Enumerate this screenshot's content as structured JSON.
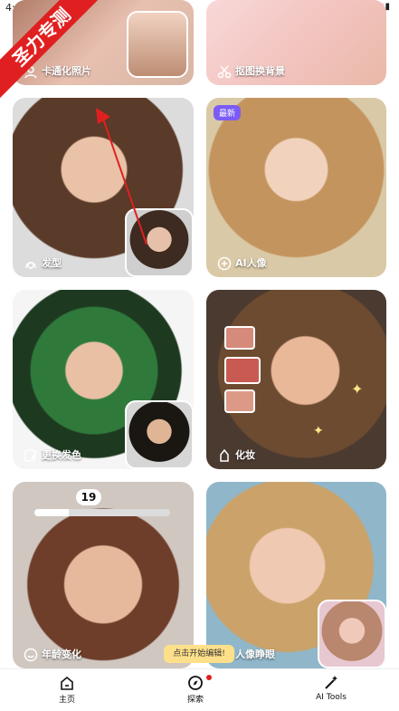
{
  "status": {
    "time": "4:42"
  },
  "watermark": "圣力专测",
  "cards": {
    "cartoon": {
      "label": "卡通化照片",
      "icon": "user-cartoon-icon"
    },
    "bgremove": {
      "label": "抠图换背景",
      "icon": "scissors-icon"
    },
    "hair": {
      "label": "发型",
      "icon": "hairstyle-icon"
    },
    "ai_portrait": {
      "label": "AI人像",
      "badge": "最新",
      "icon": "ai-icon"
    },
    "hair_color": {
      "label": "更换发色",
      "icon": "brush-icon"
    },
    "makeup": {
      "label": "化妆",
      "icon": "makeup-icon"
    },
    "age": {
      "label": "年龄变化",
      "age_value": "19",
      "progress": 0.25,
      "icon": "age-icon"
    },
    "eyes": {
      "label": "人像睁眼",
      "icon": "eye-icon"
    }
  },
  "tooltip": "点击开始编辑!",
  "nav": {
    "home": "主页",
    "explore": "探索",
    "ai_tools": "AI Tools"
  },
  "colors": {
    "accent": "#7b5cf6",
    "notice": "#ffe08a",
    "arrow": "#e02020"
  }
}
